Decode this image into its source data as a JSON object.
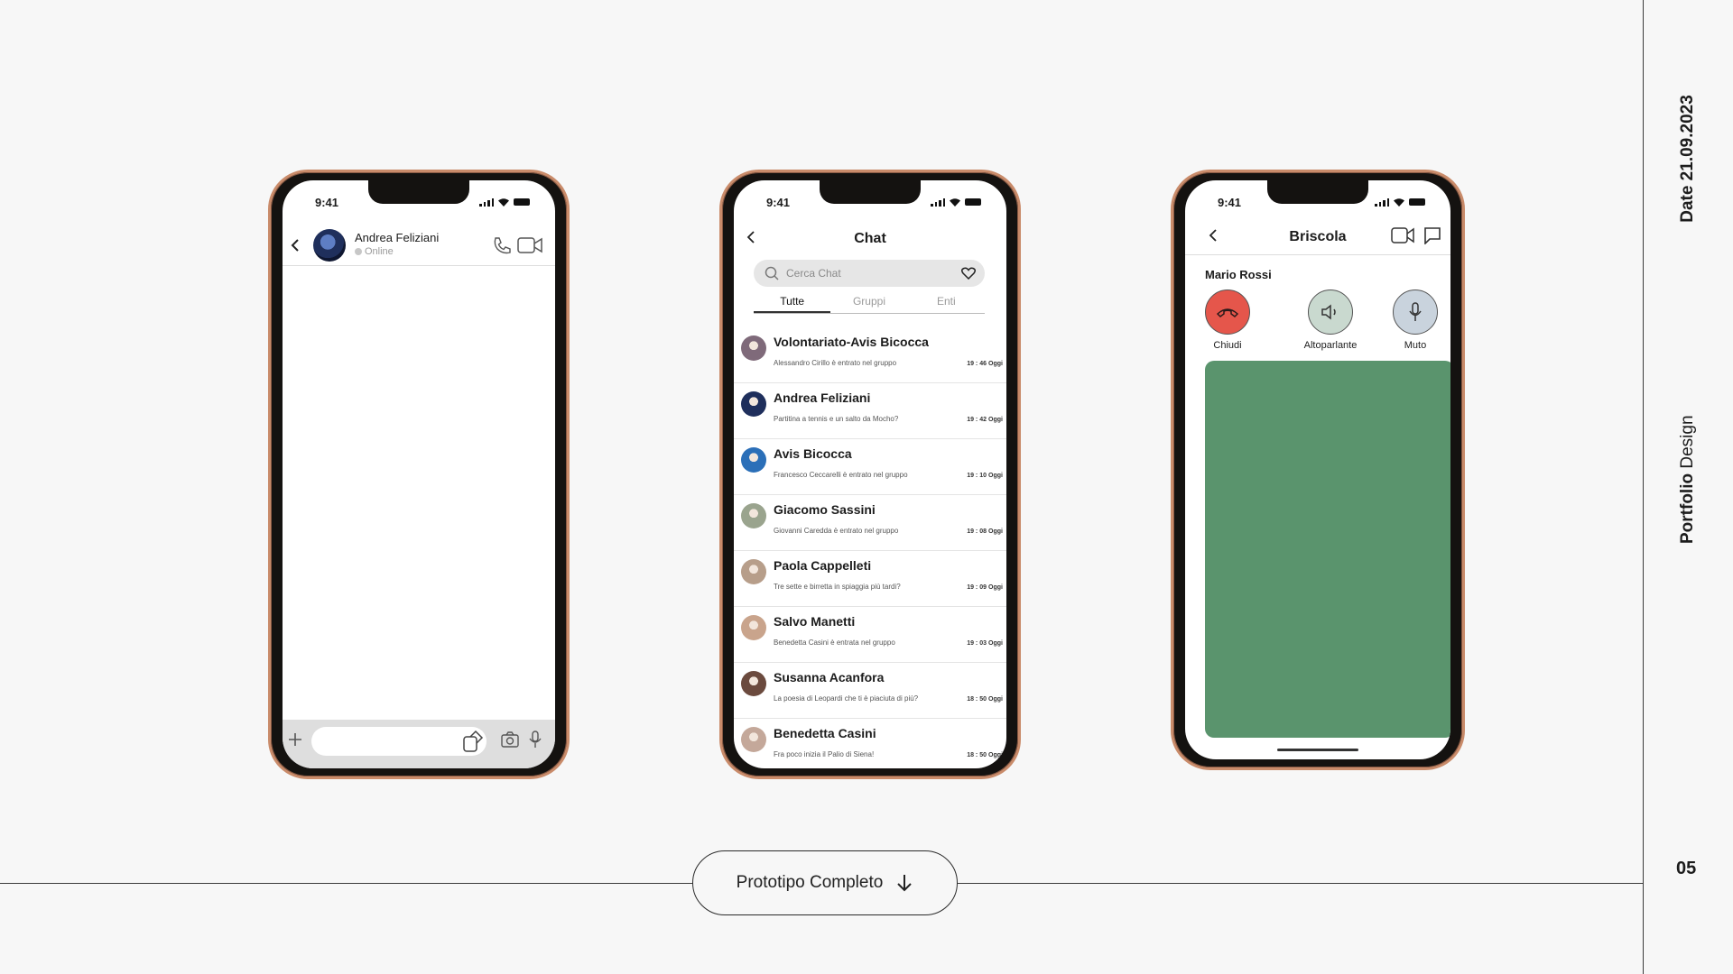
{
  "slide": {
    "date_label": "Date 21.09.2023",
    "portfolio_bold": "Portfolio",
    "portfolio_light": " Design",
    "page_number": "05",
    "cta_label": "Prototipo Completo"
  },
  "phone1": {
    "time": "9:41",
    "contact_name": "Andrea Feliziani",
    "status": "Online"
  },
  "phone2": {
    "time": "9:41",
    "title": "Chat",
    "search_placeholder": "Cerca Chat",
    "tabs": [
      "Tutte",
      "Gruppi",
      "Enti"
    ],
    "chats": [
      {
        "name": "Volontariato-Avis Bicocca",
        "message": "Alessandro Cirillo è entrato nel gruppo",
        "time": "19 : 46",
        "day": "Oggi",
        "color": "#7f6a7a"
      },
      {
        "name": "Andrea Feliziani",
        "message": "Partitina a tennis e un salto da Mocho?",
        "time": "19 : 42",
        "day": "Oggi",
        "color": "#1f2f5c"
      },
      {
        "name": "Avis Bicocca",
        "message": "Francesco Ceccarelli è entrato nel gruppo",
        "time": "19 : 10",
        "day": "Oggi",
        "color": "#2b6fb8"
      },
      {
        "name": "Giacomo Sassini",
        "message": "Giovanni Caredda è entrato nel gruppo",
        "time": "19 : 08",
        "day": "Oggi",
        "color": "#9aa48e"
      },
      {
        "name": "Paola Cappelleti",
        "message": "Tre sette e birretta  in spiaggia più tardi?",
        "time": "19 : 09",
        "day": "Oggi",
        "color": "#b79e8a"
      },
      {
        "name": "Salvo Manetti",
        "message": "Benedetta Casini è entrata nel gruppo",
        "time": "19 : 03",
        "day": "Oggi",
        "color": "#c9a48c"
      },
      {
        "name": "Susanna Acanfora",
        "message": "La poesia di Leopardi che ti è piaciuta di più?",
        "time": "18 : 50",
        "day": "Oggi",
        "color": "#6b4a3e"
      },
      {
        "name": "Benedetta Casini",
        "message": "Fra poco inizia il Palio di Siena!",
        "time": "18 : 50",
        "day": "Oggi",
        "color": "#c4a89a"
      }
    ]
  },
  "phone3": {
    "time": "9:41",
    "title": "Briscola",
    "caller": "Mario Rossi",
    "buttons": [
      "Chiudi",
      "Altoparlante",
      "Muto"
    ],
    "colors": {
      "hangup": "#e5564b",
      "speaker": "#c9d9cf",
      "mute": "#c9d3dd",
      "video": "#5a946d"
    }
  },
  "icons": [
    "back-arrow-icon",
    "phone-icon",
    "video-icon",
    "plus-icon",
    "sticker-icon",
    "camera-icon",
    "mic-icon",
    "search-icon",
    "heart-icon",
    "chat-icon",
    "hangup-icon",
    "speaker-icon",
    "arrow-down-icon"
  ]
}
